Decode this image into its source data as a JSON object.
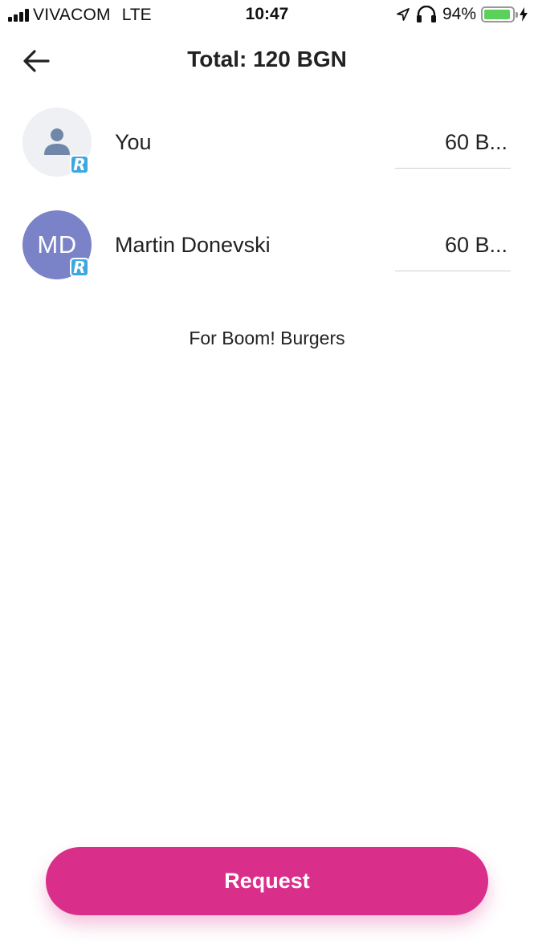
{
  "status_bar": {
    "carrier": "VIVACOM",
    "network": "LTE",
    "time": "10:47",
    "battery_percent": "94%",
    "battery_level": 0.94,
    "battery_color": "#5ad15a",
    "icons": [
      "signal-icon",
      "location-arrow-icon",
      "headphones-icon",
      "battery-icon",
      "charging-bolt-icon"
    ]
  },
  "header": {
    "back_icon": "arrow-left-icon",
    "title": "Total: 120 BGN"
  },
  "participants": [
    {
      "avatar_icon": "person-icon",
      "badge": "R",
      "name": "You",
      "amount": "60 B..."
    },
    {
      "initials": "MD",
      "badge": "R",
      "name": "Martin Donevski",
      "amount": "60 B..."
    }
  ],
  "description": "For Boom! Burgers",
  "request_button": {
    "label": "Request",
    "color": "#d92f8a"
  }
}
